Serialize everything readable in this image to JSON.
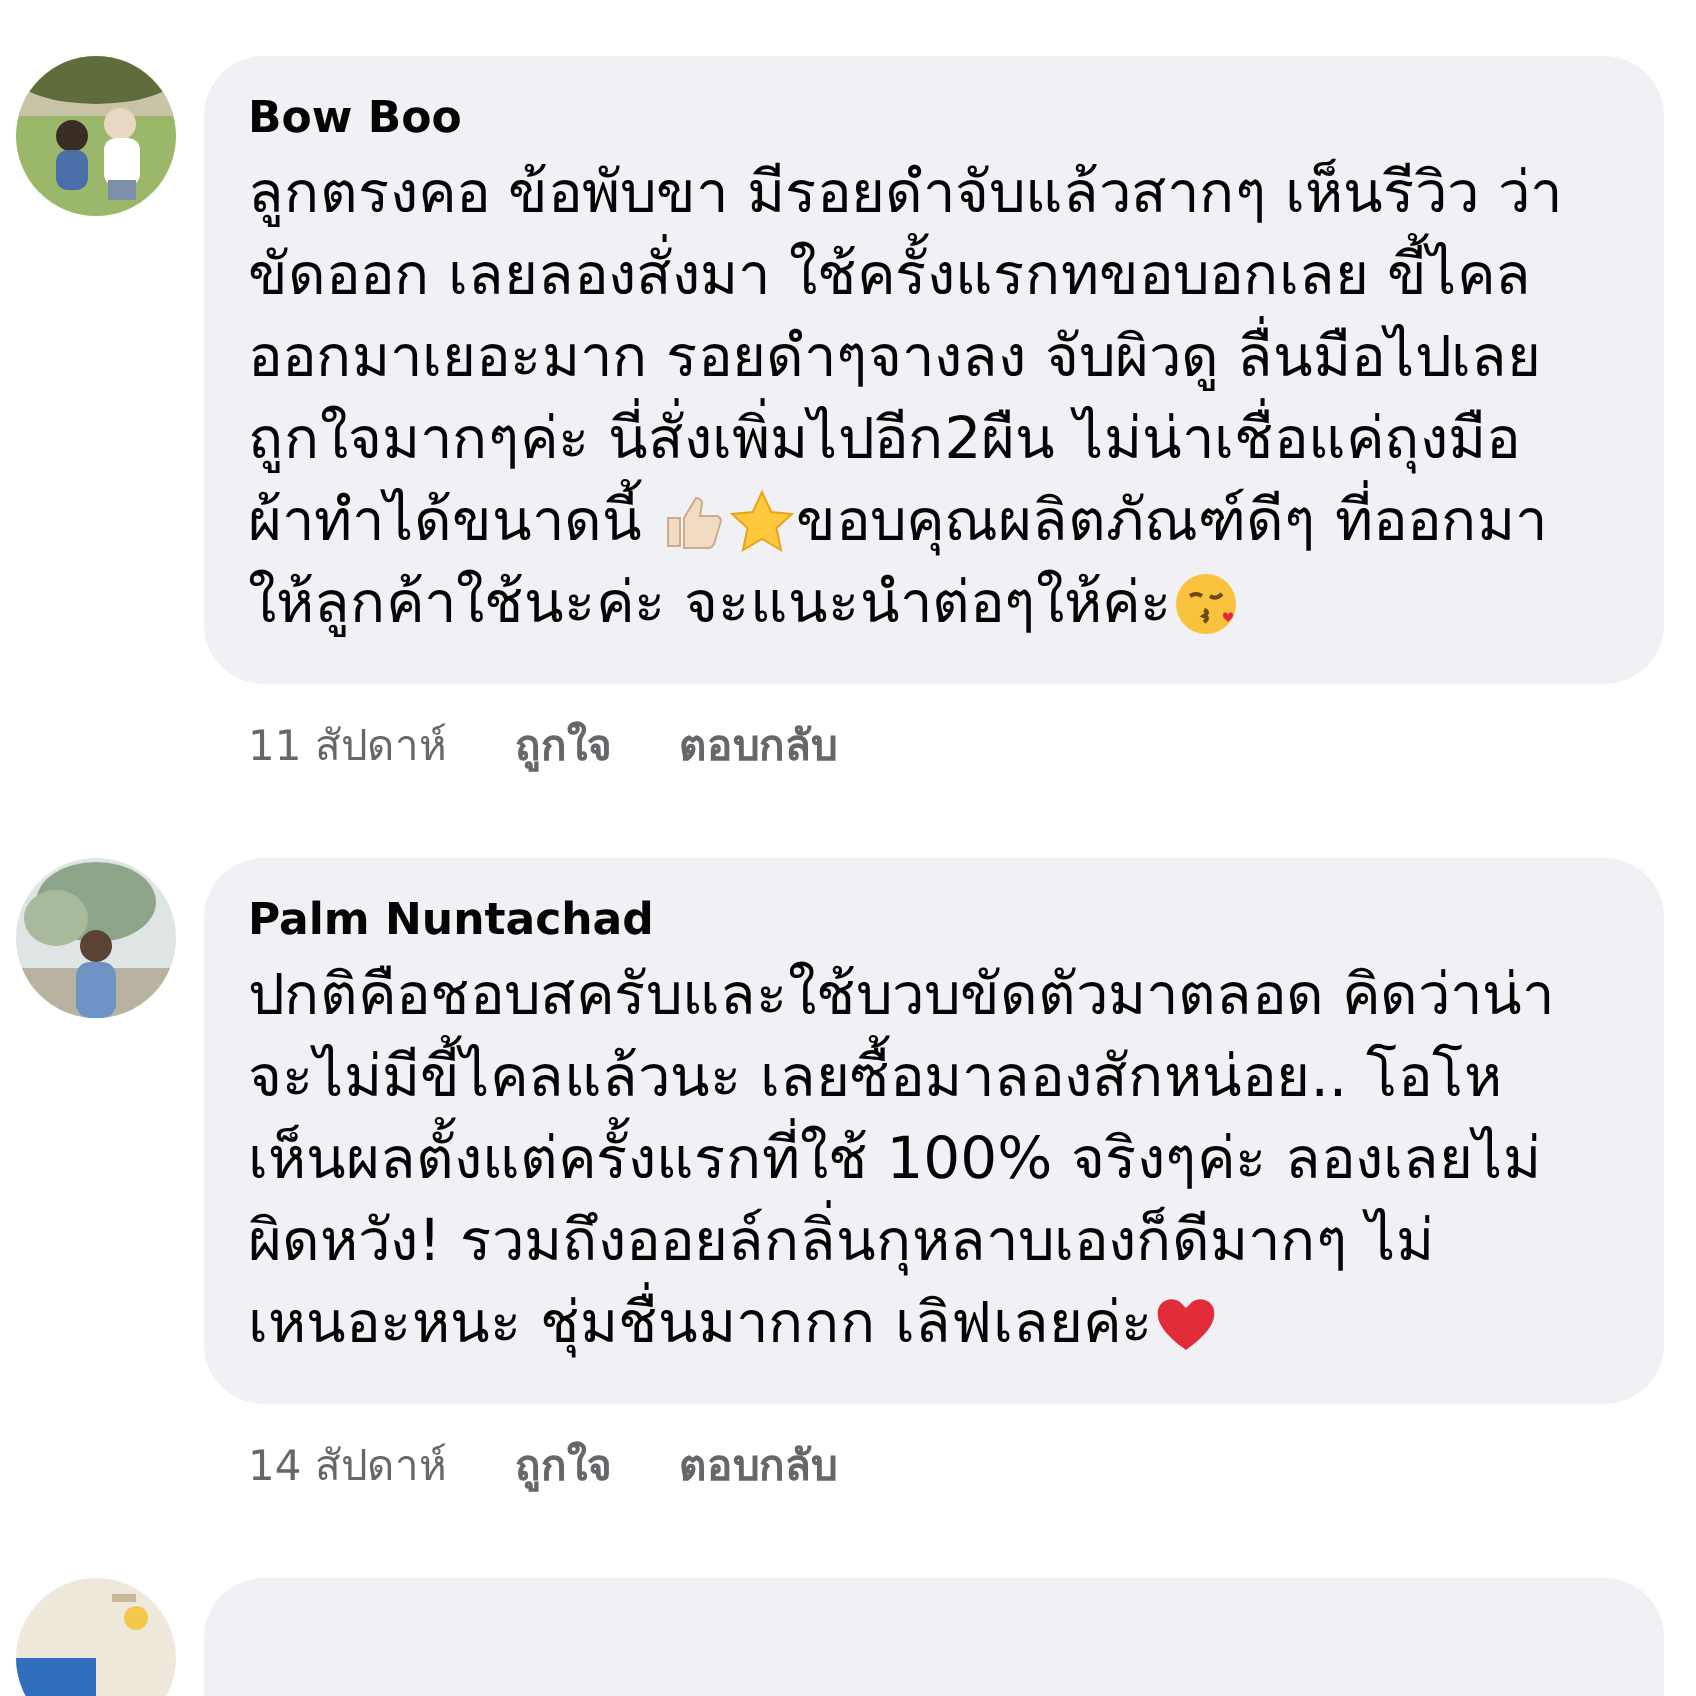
{
  "comments": [
    {
      "author": "Bow Boo",
      "avatar": {
        "kind": "picture"
      },
      "lines": [
        [
          {
            "kind": "text",
            "text": "ลูกตรงคอ ข้อพับขา มีรอยดำจับแล้วสากๆ เห็นรีวิว ว่า"
          }
        ],
        [
          {
            "kind": "text",
            "text": "ขัดออก เลยลองสั่งมา ใช้ครั้งแรกทขอบอกเลย ขี้ไคล"
          }
        ],
        [
          {
            "kind": "text",
            "text": "ออกมาเยอะมาก รอยดำๆจางลง จับผิวดู ลื่นมือไปเลย"
          }
        ],
        [
          {
            "kind": "text",
            "text": "ถูกใจมากๆค่ะ นี่สั่งเพิ่มไปอีก2ผืน ไม่น่าเชื่อแค่ถุงมือ"
          }
        ],
        [
          {
            "kind": "text",
            "text": "ผ้าทำได้ขนาดนี้ "
          },
          {
            "kind": "thumbs-up"
          },
          {
            "kind": "star"
          },
          {
            "kind": "text",
            "text": "ขอบคุณผลิตภัณฑ์ดีๆ ที่ออกมา"
          }
        ],
        [
          {
            "kind": "text",
            "text": "ให้ลูกค้าใช้นะค่ะ จะแนะนำต่อๆให้ค่ะ"
          },
          {
            "kind": "kiss"
          }
        ]
      ],
      "time": "11 สัปดาห์",
      "actions": [
        "ถูกใจ",
        "ตอบกลับ"
      ]
    },
    {
      "author": "Palm Nuntachad",
      "avatar": {
        "kind": "picture"
      },
      "lines": [
        [
          {
            "kind": "text",
            "text": "ปกติคือชอบสครับและใช้บวบขัดตัวมาตลอด คิดว่าน่า"
          }
        ],
        [
          {
            "kind": "text",
            "text": "จะไม่มีขี้ไคลแล้วนะ เลยซื้อมาลองสักหน่อย.. โอโห"
          }
        ],
        [
          {
            "kind": "text",
            "text": "เห็นผลตั้งแต่ครั้งแรกที่ใช้ 100% จริงๆค่ะ ลองเลยไม่"
          }
        ],
        [
          {
            "kind": "text",
            "text": "ผิดหวัง! รวมถึงออยล์กลิ่นกุหลาบเองก็ดีมากๆ ไม่"
          }
        ],
        [
          {
            "kind": "text",
            "text": "เหนอะหนะ ชุ่มชื่นมากกก เลิฟเลยค่ะ"
          },
          {
            "kind": "heart"
          }
        ]
      ],
      "time": "14 สัปดาห์",
      "actions": [
        "ถูกใจ",
        "ตอบกลับ"
      ]
    }
  ],
  "next_comment": {
    "avatar": {
      "kind": "picture"
    }
  }
}
